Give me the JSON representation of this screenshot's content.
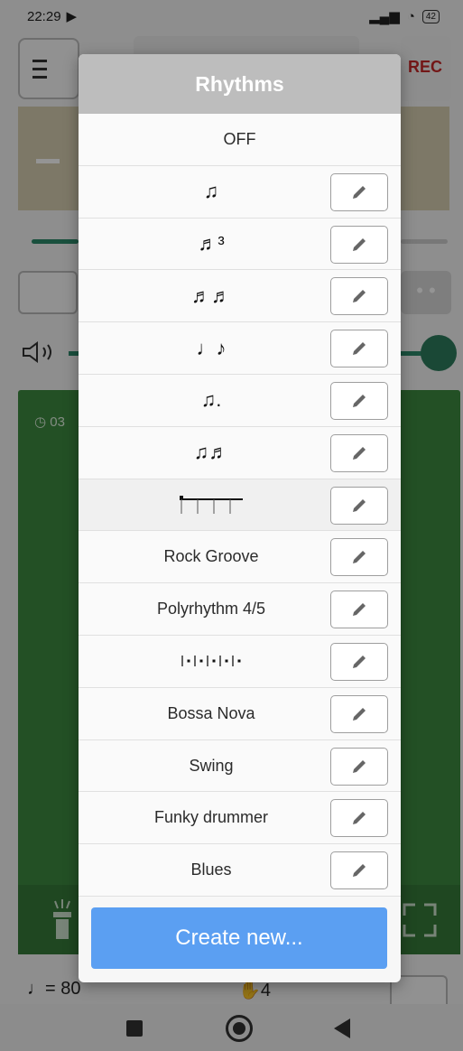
{
  "status_bar": {
    "time": "22:29",
    "battery": "42"
  },
  "app": {
    "rec_label": "REC",
    "clock_text": "03",
    "bpm_label": "♩= 80",
    "meter_label": "4"
  },
  "dialog": {
    "title": "Rhythms",
    "off_label": "OFF",
    "rows": [
      {
        "label": "♫",
        "kind": "symbol"
      },
      {
        "label": "♬³",
        "kind": "symbol"
      },
      {
        "label": "♬♬",
        "kind": "symbol"
      },
      {
        "label": "♩♪",
        "kind": "symbol"
      },
      {
        "label": "♫.",
        "kind": "symbol"
      },
      {
        "label": "♫♬",
        "kind": "symbol"
      },
      {
        "label": "",
        "kind": "pattern-bars"
      },
      {
        "label": "Rock Groove",
        "kind": "text"
      },
      {
        "label": "Polyrhythm 4/5",
        "kind": "text"
      },
      {
        "label": "",
        "kind": "pattern-dots"
      },
      {
        "label": "Bossa Nova",
        "kind": "text"
      },
      {
        "label": "Swing",
        "kind": "text"
      },
      {
        "label": "Funky drummer",
        "kind": "text"
      },
      {
        "label": "Blues",
        "kind": "text"
      }
    ],
    "create_label": "Create new..."
  },
  "icons": {
    "edit": "pencil-icon",
    "menu": "hamburger-icon",
    "volume": "speaker-icon",
    "flashlight": "flashlight-icon",
    "fullscreen": "fullscreen-icon"
  },
  "colors": {
    "accent": "#5b9ff2",
    "green_panel": "#3d8a40",
    "rec": "#c62828"
  }
}
